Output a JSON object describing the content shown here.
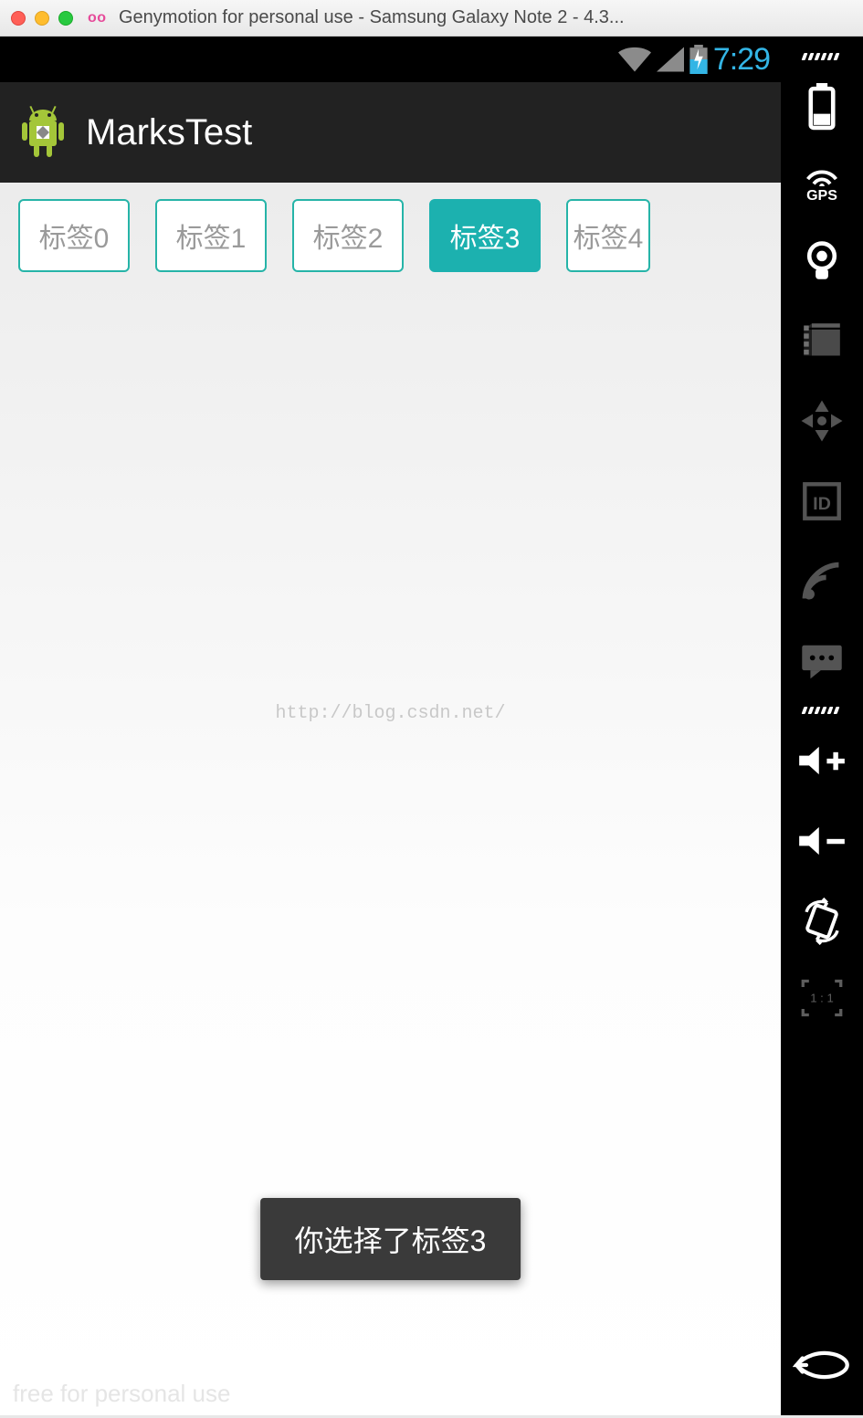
{
  "window": {
    "title": "Genymotion for personal use - Samsung Galaxy Note 2 - 4.3..."
  },
  "statusbar": {
    "clock": "7:29"
  },
  "app": {
    "title": "MarksTest"
  },
  "tabs": [
    {
      "label": "标签0",
      "active": false
    },
    {
      "label": "标签1",
      "active": false
    },
    {
      "label": "标签2",
      "active": false
    },
    {
      "label": "标签3",
      "active": true
    },
    {
      "label": "标签4",
      "active": false
    }
  ],
  "watermark": "http://blog.csdn.net/",
  "toast": "你选择了标签3",
  "footer": "free for personal use",
  "sidebar": {
    "gps_label": "GPS",
    "id_label": "ID",
    "aspect_label": "1 : 1"
  }
}
